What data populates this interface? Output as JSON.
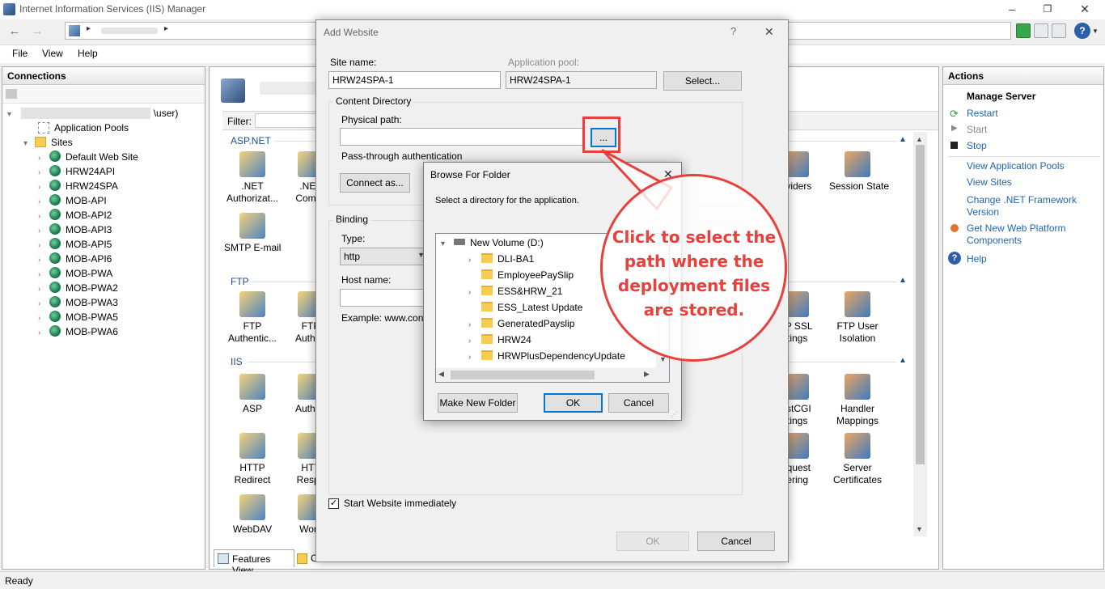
{
  "window": {
    "title": "Internet Information Services (IIS) Manager",
    "controls": {
      "minimize": "–",
      "restore": "❐",
      "close": "✕"
    }
  },
  "addressbar": {
    "back": "←",
    "forward": "→",
    "sep": "▸",
    "help_glyph": "?"
  },
  "menu": {
    "file": "File",
    "view": "View",
    "help": "Help"
  },
  "connections": {
    "header": "Connections",
    "server_label": "\\user)",
    "app_pools": "Application Pools",
    "sites": "Sites",
    "site_list": [
      "Default Web Site",
      "HRW24API",
      "HRW24SPA",
      "MOB-API",
      "MOB-API2",
      "MOB-API3",
      "MOB-API5",
      "MOB-API6",
      "MOB-PWA",
      "MOB-PWA2",
      "MOB-PWA3",
      "MOB-PWA5",
      "MOB-PWA6"
    ]
  },
  "center": {
    "filter_label": "Filter:",
    "groups": {
      "aspnet": "ASP.NET",
      "ftp": "FTP",
      "iis": "IIS"
    },
    "features_left": [
      {
        "label": ".NET\nAuthorizat...",
        "icon": "net-authorization-icon"
      },
      {
        "label": ".NET\nCompil",
        "icon": "net-compilation-icon"
      },
      {
        "label": "SMTP E-mail",
        "icon": "smtp-email-icon"
      },
      {
        "label": "FTP\nAuthentic...",
        "icon": "ftp-authentication-icon"
      },
      {
        "label": "FTP\nAuthori",
        "icon": "ftp-authorization-icon"
      },
      {
        "label": "ASP",
        "icon": "asp-icon"
      },
      {
        "label": "Authen",
        "icon": "authentication-icon"
      },
      {
        "label": "HTTP\nRedirect",
        "icon": "http-redirect-icon"
      },
      {
        "label": "HTT\nRespo",
        "icon": "http-response-icon"
      },
      {
        "label": "WebDAV",
        "icon": "webdav-icon"
      },
      {
        "label": "Work",
        "icon": "worker-icon"
      }
    ],
    "features_right": [
      {
        "label": "oviders",
        "icon": "providers-icon"
      },
      {
        "label": "Session State",
        "icon": "session-state-icon"
      },
      {
        "label": "TP SSL\nttings",
        "icon": "ftp-ssl-icon"
      },
      {
        "label": "FTP User\nIsolation",
        "icon": "ftp-user-isolation-icon"
      },
      {
        "label": "astCGI\nttings",
        "icon": "fastcgi-icon"
      },
      {
        "label": "Handler\nMappings",
        "icon": "handler-mappings-icon"
      },
      {
        "label": "equest\ntering",
        "icon": "request-filtering-icon"
      },
      {
        "label": "Server\nCertificates",
        "icon": "server-certificates-icon"
      }
    ],
    "tab_features": "Features View",
    "tab_content": "C"
  },
  "actions": {
    "header": "Actions",
    "manage_server": "Manage Server",
    "restart": "Restart",
    "start": "Start",
    "stop": "Stop",
    "view_app_pools": "View Application Pools",
    "view_sites": "View Sites",
    "change_net": "Change .NET Framework Version",
    "get_platform": "Get New Web Platform Components",
    "help": "Help"
  },
  "add_website": {
    "title": "Add Website",
    "help_glyph": "?",
    "close_glyph": "✕",
    "site_name_label": "Site name:",
    "site_name_value": "HRW24SPA-1",
    "app_pool_label": "Application pool:",
    "app_pool_value": "HRW24SPA-1",
    "select_button": "Select...",
    "content_dir_label": "Content Directory",
    "physical_path_label": "Physical path:",
    "physical_path_value": "",
    "browse_button": "...",
    "passthrough_label": "Pass-through authentication",
    "connect_as_button": "Connect as...",
    "binding_label": "Binding",
    "type_label": "Type:",
    "type_value": "http",
    "host_name_label": "Host name:",
    "example_text": "Example: www.con",
    "start_immediately": "Start Website immediately",
    "ok_button": "OK",
    "cancel_button": "Cancel"
  },
  "browse_folder": {
    "title": "Browse For Folder",
    "close_glyph": "✕",
    "instruction": "Select a directory for the application.",
    "drive": "New Volume (D:)",
    "folders": [
      {
        "name": "DLI-BA1",
        "expandable": true
      },
      {
        "name": "EmployeePaySlip",
        "expandable": false
      },
      {
        "name": "ESS&HRW_21",
        "expandable": true
      },
      {
        "name": "ESS_Latest Update",
        "expandable": false
      },
      {
        "name": "GeneratedPayslip",
        "expandable": true
      },
      {
        "name": "HRW24",
        "expandable": true
      },
      {
        "name": "HRWPlusDependencyUpdate",
        "expandable": true
      }
    ],
    "make_new_folder": "Make New Folder",
    "ok_button": "OK",
    "cancel_button": "Cancel"
  },
  "annotation": {
    "text": "Click to select the path where the deployment files are stored.",
    "color": "#e8403d"
  },
  "status": {
    "text": "Ready"
  }
}
